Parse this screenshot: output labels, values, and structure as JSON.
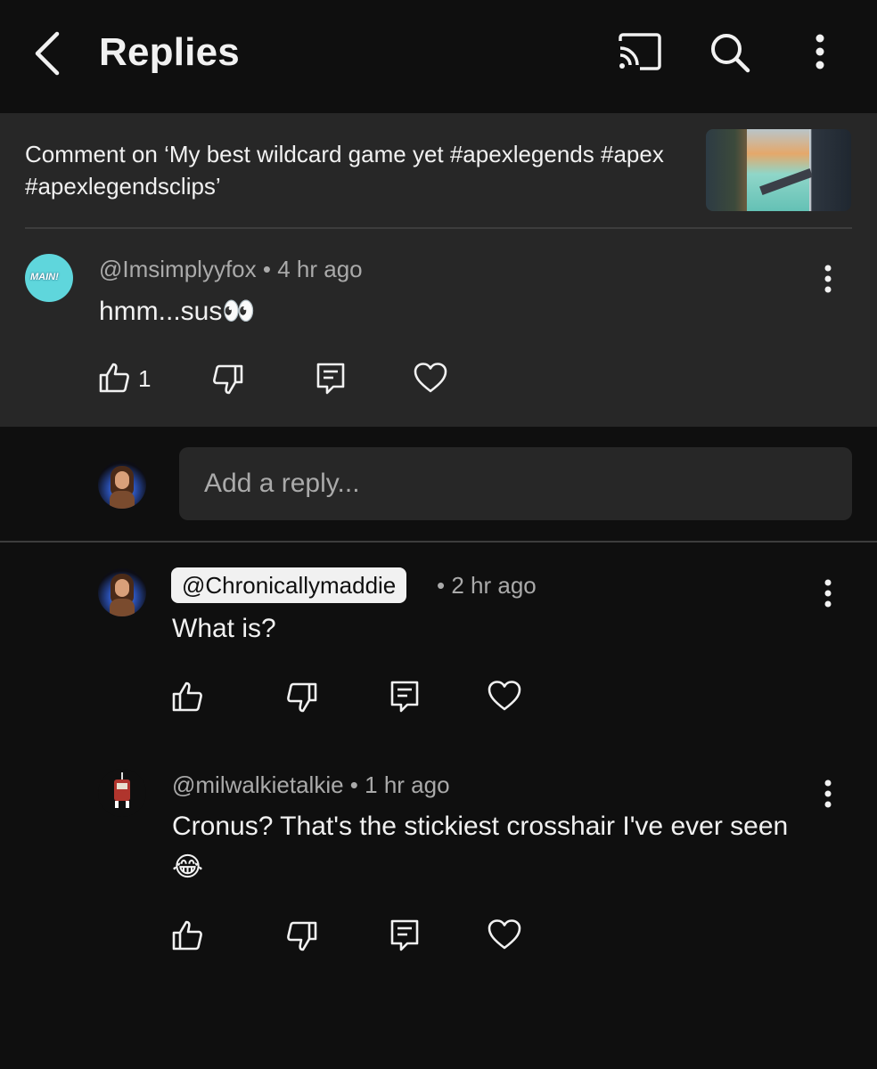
{
  "header": {
    "title": "Replies",
    "icons": [
      "back-icon",
      "cast-icon",
      "search-icon",
      "more-vertical-icon"
    ]
  },
  "context": {
    "text": "Comment on ‘My best wildcard game yet #apexlegends #apex #apexlegendsclips’"
  },
  "parent_comment": {
    "handle": "@Imsimplyyfox",
    "time": "4 hr ago",
    "text": "hmm...sus👀",
    "likes": "1",
    "avatar_label": "MAIN!"
  },
  "reply_box": {
    "placeholder": "Add a reply..."
  },
  "replies": [
    {
      "handle": "@Chronicallymaddie",
      "time": "2 hr ago",
      "text": "What is?",
      "highlighted": true
    },
    {
      "handle": "@milwalkietalkie",
      "time": "1 hr ago",
      "text": "Cronus? That's the stickiest crosshair I've ever seen 😂",
      "highlighted": false
    }
  ],
  "separator": "•",
  "colors": {
    "background": "#0f0f0f",
    "surface": "#272727",
    "text": "#f1f1f1",
    "secondary_text": "#aaaaaa",
    "chip_bg": "#f1f1f1"
  }
}
